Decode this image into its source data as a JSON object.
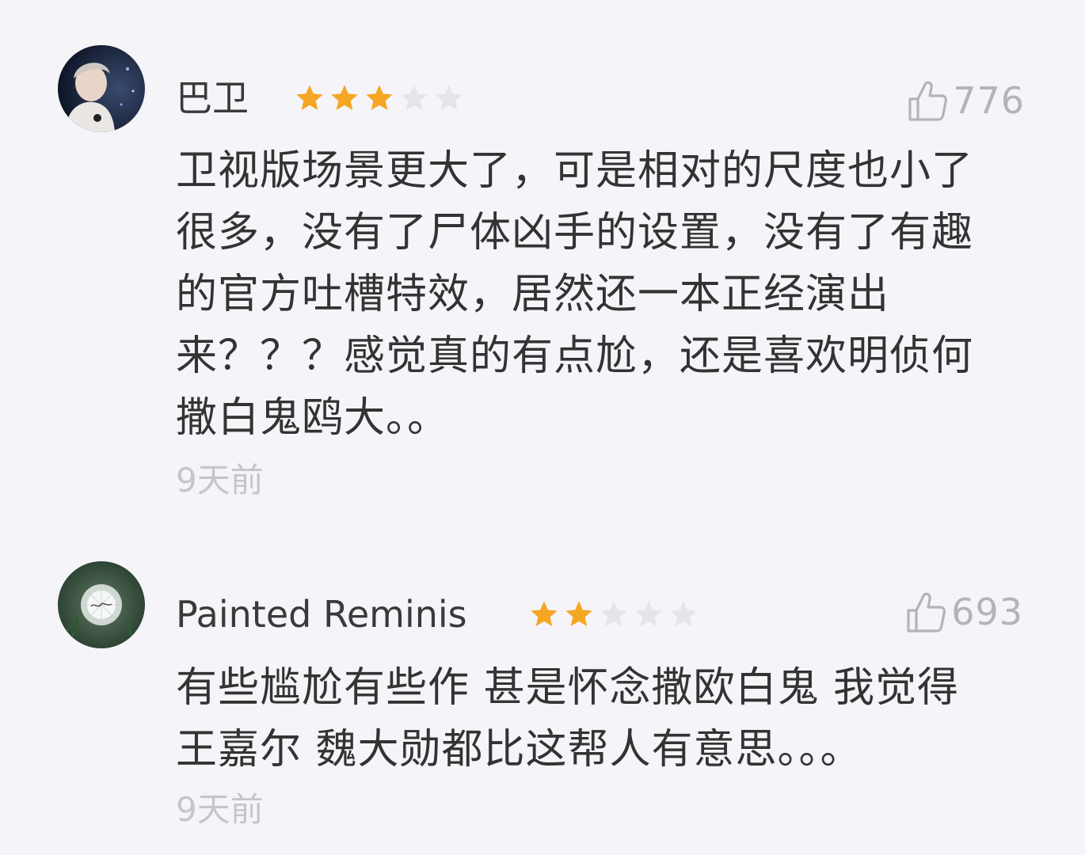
{
  "comments": [
    {
      "username": "巴卫",
      "rating": 3,
      "max_rating": 5,
      "likes": "776",
      "avatar_icon": "avatar-photo-person",
      "content_lines": [
        "卫视版场景更大了，可是相对的尺度也小了",
        "很多，没有了尸体凶手的设置，没有了有趣",
        "的官方吐槽特效，居然还一本正经演出",
        "来？？？感觉真的有点尬，还是喜欢明侦何",
        "撒白鬼鸥大。。"
      ],
      "time": "9天前"
    },
    {
      "username": "Painted Reminis",
      "rating": 2,
      "max_rating": 5,
      "likes": "693",
      "avatar_icon": "avatar-dandelion",
      "content_lines": [
        "有些尴尬有些作 甚是怀念撒欧白鬼 我觉得",
        "王嘉尔 魏大勋都比这帮人有意思。。。"
      ],
      "time": "9天前"
    }
  ],
  "colors": {
    "background": "#f5f4f8",
    "star_on": "#f5a623",
    "star_off": "#e5e4e8",
    "muted": "#b4b4b8"
  },
  "icons": {
    "like": "thumbs-up-icon",
    "star": "star-icon"
  }
}
